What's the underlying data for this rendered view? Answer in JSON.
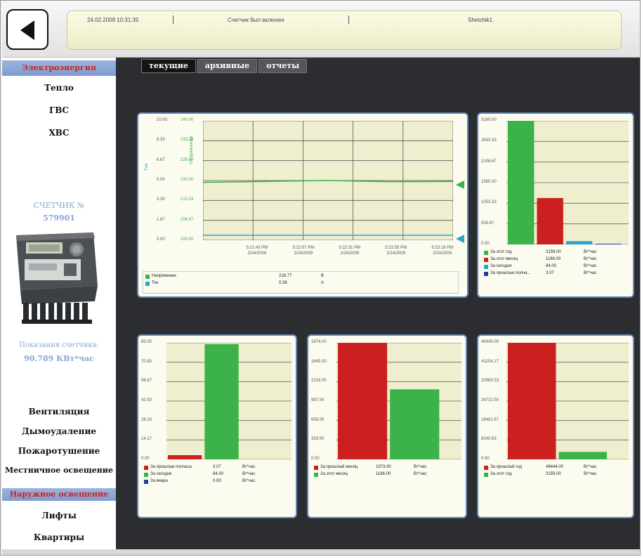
{
  "header": {
    "datetime": "24.02.2009 10:31:35",
    "message": "Счетчик был включен",
    "source": "Shetchik1"
  },
  "sidebar": {
    "items_top": [
      "Электроэнергия",
      "Тепло",
      "ГВС",
      "ХВС"
    ],
    "meter_label": "СЧЕТЧИК №",
    "meter_number": "579901",
    "reading_label": "Показания счетчика:",
    "reading_value": "90.789 КВт*час",
    "items_bottom": [
      "Вентиляция",
      "Дымоудаление",
      "Пожаротушение",
      "Местничное освещение",
      "Наружное освещение",
      "Лифты",
      "Квартиры"
    ]
  },
  "tabs": [
    "текущие",
    "архивные",
    "отчеты"
  ],
  "colors": {
    "green": "#3cb34a",
    "red": "#cc1f1f",
    "teal": "#2aa5c9",
    "blue": "#2340a0",
    "accent": "#d0201e"
  },
  "trend": {
    "left_axis": {
      "label": "Ток",
      "ticks": [
        "10.00",
        "8.33",
        "6.67",
        "5.00",
        "3.33",
        "1.67",
        "0.00"
      ]
    },
    "right_axis": {
      "label": "Напряжение",
      "ticks": [
        "240.00",
        "233.33",
        "226.67",
        "220.00",
        "213.33",
        "206.67",
        "200.00"
      ]
    },
    "x_ticks": [
      {
        "time": "5:21:43 PM",
        "date": "2/24/2009"
      },
      {
        "time": "5:22:07 PM",
        "date": "2/24/2009"
      },
      {
        "time": "5:22:31 PM",
        "date": "2/24/2009"
      },
      {
        "time": "5:22:55 PM",
        "date": "2/24/2009"
      },
      {
        "time": "5:23:19 PM",
        "date": "2/24/2009"
      }
    ],
    "legend": [
      {
        "name": "Напряжение",
        "value": "218.77",
        "unit": "В",
        "color": "#3cb34a"
      },
      {
        "name": "Ток",
        "value": "0.36",
        "unit": "А",
        "color": "#2aa5c9"
      }
    ]
  },
  "chart_data": [
    {
      "type": "line",
      "x": [
        "5:21:43 PM",
        "5:22:07 PM",
        "5:22:31 PM",
        "5:22:55 PM",
        "5:23:19 PM"
      ],
      "series": [
        {
          "name": "Напряжение",
          "values": [
            219.4,
            219.7,
            220.0,
            219.6,
            219.7
          ]
        },
        {
          "name": "Ток",
          "values": [
            0.36,
            0.36,
            0.36,
            0.36,
            0.36
          ]
        }
      ],
      "ylim": [
        200,
        240
      ],
      "y2lim": [
        0,
        10
      ]
    },
    {
      "type": "bar",
      "ylim": [
        0,
        3160
      ],
      "ticks": [
        "3160.00",
        "2633.33",
        "2106.67",
        "1580.00",
        "1053.33",
        "526.67",
        "0.00"
      ],
      "values": [
        3159.0,
        1186.0,
        84.0,
        3.07
      ],
      "legend": [
        {
          "name": "За этот год",
          "value": "3159.00",
          "unit": "Вт*час",
          "color": "#3cb34a"
        },
        {
          "name": "За этот месяц",
          "value": "1186.00",
          "unit": "Вт*час",
          "color": "#cc1f1f"
        },
        {
          "name": "За сегодня",
          "value": "84.00",
          "unit": "Вт*час",
          "color": "#2aa5c9"
        },
        {
          "name": "За прошлые полча...",
          "value": "3.07",
          "unit": "Вт*час",
          "color": "#2340a0"
        }
      ]
    },
    {
      "type": "bar",
      "ylim": [
        0,
        85
      ],
      "ticks": [
        "85.00",
        "70.83",
        "56.67",
        "42.50",
        "28.33",
        "14.17",
        "0.00"
      ],
      "values": [
        3.07,
        84.0,
        0.0
      ],
      "legend": [
        {
          "name": "За прошлые полчаса",
          "value": "3.07",
          "unit": "Вт*час",
          "color": "#cc1f1f"
        },
        {
          "name": "За сегодня",
          "value": "84.00",
          "unit": "Вт*час",
          "color": "#3cb34a"
        },
        {
          "name": "За вчера",
          "value": "0.00",
          "unit": "Вт*час",
          "color": "#2340a0"
        }
      ]
    },
    {
      "type": "bar",
      "ylim": [
        0,
        1974
      ],
      "ticks": [
        "1974.00",
        "1645.00",
        "1316.00",
        "987.00",
        "658.00",
        "329.00",
        "0.00"
      ],
      "values": [
        1973.0,
        1186.0
      ],
      "legend": [
        {
          "name": "За прошлый месяц",
          "value": "1973.00",
          "unit": "Вт*час",
          "color": "#cc1f1f"
        },
        {
          "name": "За этот месяц",
          "value": "1186.00",
          "unit": "Вт*час",
          "color": "#3cb34a"
        }
      ]
    },
    {
      "type": "bar",
      "ylim": [
        0,
        49445
      ],
      "ticks": [
        "49445.00",
        "41204.17",
        "32963.33",
        "24722.50",
        "16481.67",
        "8240.83",
        "0.00"
      ],
      "values": [
        49444.0,
        3159.0
      ],
      "legend": [
        {
          "name": "За прошлый год",
          "value": "49444.00",
          "unit": "Вт*час",
          "color": "#cc1f1f"
        },
        {
          "name": "За этот год",
          "value": "3159.00",
          "unit": "Вт*час",
          "color": "#3cb34a"
        }
      ]
    }
  ]
}
